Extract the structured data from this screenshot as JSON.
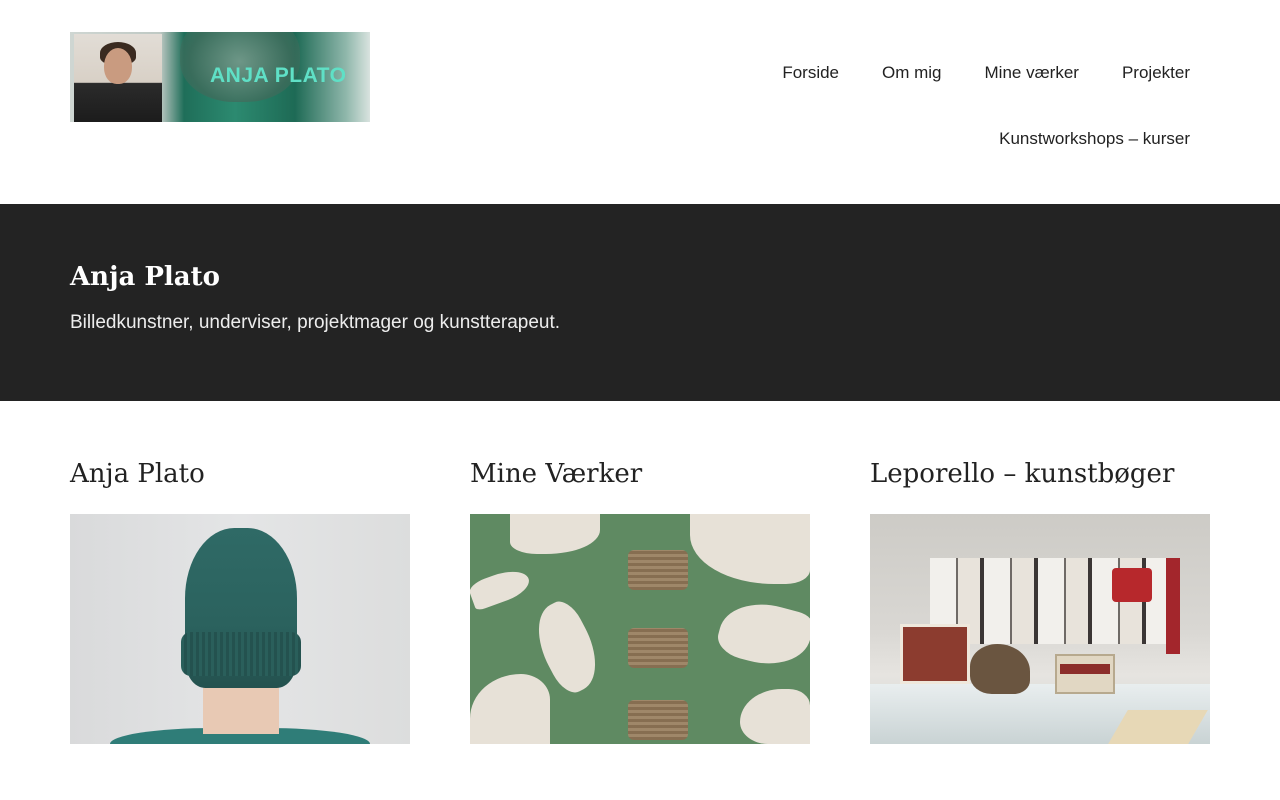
{
  "header": {
    "logo": {
      "text": "ANJA PLATO",
      "alt": "Anja Plato logo"
    },
    "nav": {
      "row1": [
        "Forside",
        "Om mig",
        "Mine værker",
        "Projekter"
      ],
      "row2": [
        "Kunstworkshops – kurser"
      ]
    }
  },
  "hero": {
    "title": "Anja Plato",
    "subtitle": "Billedkunstner, underviser, projektmager og kunstterapeut."
  },
  "columns": [
    {
      "title": "Anja Plato",
      "image": "portrait-green-hat"
    },
    {
      "title": "Mine Værker",
      "image": "green-abstract-artwork"
    },
    {
      "title": "Leporello – kunstbøger",
      "image": "leporello-books-display"
    }
  ],
  "colors": {
    "hero_background": "#232323",
    "text": "#222222",
    "logo_accent": "#5fe0c6"
  }
}
